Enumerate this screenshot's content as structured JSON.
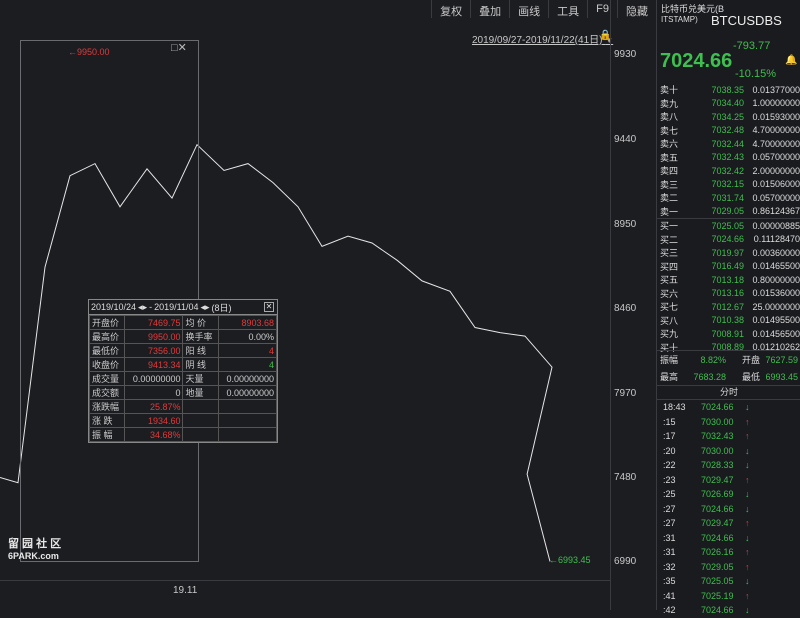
{
  "toolbar": {
    "buttons": [
      "复权",
      "叠加",
      "画线",
      "工具",
      "F9",
      "隐藏"
    ]
  },
  "chart": {
    "date_range": "2019/09/27-2019/11/22(41日)",
    "y_ticks": [
      "9930",
      "9440",
      "8950",
      "8460",
      "7970",
      "7480",
      "6990"
    ],
    "x_tick": "19.11",
    "high_label": "9950.00",
    "low_label": "6993.45",
    "crosshair_icons": "□✕",
    "watermark_line1": "留 园 社 区",
    "watermark_line2": "6PARK.com"
  },
  "chart_data": {
    "type": "line",
    "ylim": [
      6900,
      10000
    ],
    "x_ticks": [
      "19.11"
    ],
    "y_ticks": [
      9930,
      9440,
      8950,
      8460,
      7970,
      7480,
      6990
    ],
    "series": [
      {
        "values": [
          7480,
          7450,
          8700,
          9230,
          9300,
          9050,
          9270,
          9100,
          9410,
          9260,
          9300,
          9190,
          9050,
          8820,
          8880,
          8840,
          8740,
          8620,
          8560,
          8350,
          8320,
          8300,
          8120,
          7500,
          6993
        ]
      }
    ]
  },
  "info": {
    "header_from": "2019/10/24",
    "header_arrows": "◂▸",
    "header_sep": "-",
    "header_to": "2019/11/04",
    "header_days": "(8日)",
    "close_glyph": "✕",
    "rows": [
      [
        "开盘价",
        "7469.75",
        "均 价",
        "8903.68"
      ],
      [
        "最高价",
        "9950.00",
        "换手率",
        "0.00%"
      ],
      [
        "最低价",
        "7356.00",
        "阳 线",
        "4"
      ],
      [
        "收盘价",
        "9413.34",
        "阴 线",
        "4"
      ],
      [
        "成交量",
        "0.00000000",
        "天量",
        "0.00000000"
      ],
      [
        "成交额",
        "0",
        "地量",
        "0.00000000"
      ],
      [
        "涨跌幅",
        "25.87%",
        "",
        ""
      ],
      [
        "涨 跌",
        "1934.60",
        "",
        ""
      ],
      [
        "振 幅",
        "34.68%",
        "",
        ""
      ]
    ]
  },
  "panel": {
    "name": "比特币兑美元(B",
    "sub": "ITSTAMP)",
    "code": "BTCUSDBS",
    "change": "-793.77",
    "price": "7024.66",
    "pct": "-10.15%",
    "bell": "🔔",
    "asks": [
      [
        "卖十",
        "7038.35",
        "0.01377000"
      ],
      [
        "卖九",
        "7034.40",
        "1.00000000"
      ],
      [
        "卖八",
        "7034.25",
        "0.01593000"
      ],
      [
        "卖七",
        "7032.48",
        "4.70000000"
      ],
      [
        "卖六",
        "7032.44",
        "4.70000000"
      ],
      [
        "卖五",
        "7032.43",
        "0.05700000"
      ],
      [
        "卖四",
        "7032.42",
        "2.00000000"
      ],
      [
        "卖三",
        "7032.15",
        "0.01506000"
      ],
      [
        "卖二",
        "7031.74",
        "0.05700000"
      ],
      [
        "卖一",
        "7029.05",
        "0.86124367"
      ]
    ],
    "bids": [
      [
        "买一",
        "7025.05",
        "0.00000885"
      ],
      [
        "买二",
        "7024.66",
        "0.11128470"
      ],
      [
        "买三",
        "7019.97",
        "0.00360000"
      ],
      [
        "买四",
        "7016.49",
        "0.01465500"
      ],
      [
        "买五",
        "7013.18",
        "0.80000000"
      ],
      [
        "买六",
        "7013.16",
        "0.01536000"
      ],
      [
        "买七",
        "7012.67",
        "25.0000000"
      ],
      [
        "买八",
        "7010.38",
        "0.01495500"
      ],
      [
        "买九",
        "7008.91",
        "0.01456500"
      ],
      [
        "买十",
        "7008.89",
        "0.01210262"
      ]
    ],
    "stats": {
      "zhenfu_label": "振幅",
      "zhenfu": "8.82%",
      "kaipan_label": "开盘",
      "kaipan": "7627.59",
      "zuigao_label": "最高",
      "zuigao": "7683.28",
      "zuidi_label": "最低",
      "zuidi": "6993.45"
    },
    "fenshi": "分时",
    "trades": [
      [
        "18:43",
        "7024.66",
        "down"
      ],
      [
        ":15",
        "7030.00",
        "up"
      ],
      [
        ":17",
        "7032.43",
        "up"
      ],
      [
        ":20",
        "7030.00",
        "down"
      ],
      [
        ":22",
        "7028.33",
        "down"
      ],
      [
        ":23",
        "7029.47",
        "up"
      ],
      [
        ":25",
        "7026.69",
        "down"
      ],
      [
        ":27",
        "7024.66",
        "down"
      ],
      [
        ":27",
        "7029.47",
        "up"
      ],
      [
        ":31",
        "7024.66",
        "down"
      ],
      [
        ":31",
        "7026.16",
        "up"
      ],
      [
        ":32",
        "7029.05",
        "up"
      ],
      [
        ":35",
        "7025.05",
        "down"
      ],
      [
        ":41",
        "7025.19",
        "up"
      ],
      [
        ":42",
        "7024.66",
        "down"
      ]
    ]
  }
}
